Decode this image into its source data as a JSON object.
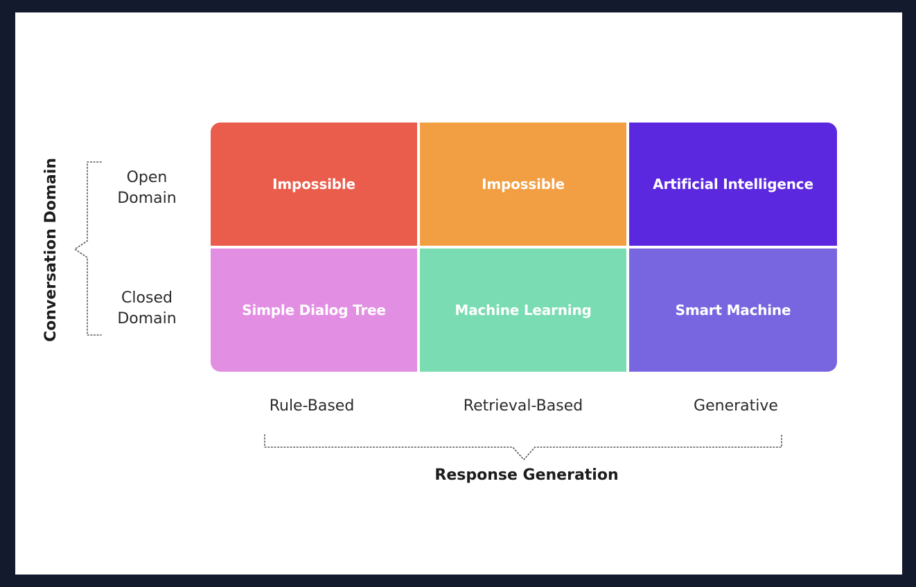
{
  "y_axis": {
    "title": "Conversation Domain",
    "rows": [
      {
        "line1": "Open",
        "line2": "Domain"
      },
      {
        "line1": "Closed",
        "line2": "Domain"
      }
    ]
  },
  "x_axis": {
    "title": "Response Generation",
    "columns": [
      "Rule-Based",
      "Retrieval-Based",
      "Generative"
    ]
  },
  "matrix": {
    "cells": [
      [
        {
          "label": "Impossible",
          "color": "#ea5c4b"
        },
        {
          "label": "Impossible",
          "color": "#f29f43"
        },
        {
          "label": "Artificial Intelligence",
          "color": "#5b28df"
        }
      ],
      [
        {
          "label": "Simple Dialog Tree",
          "color": "#e28fe3"
        },
        {
          "label": "Machine Learning",
          "color": "#79dcb2"
        },
        {
          "label": "Smart Machine",
          "color": "#7866e0"
        }
      ]
    ]
  },
  "colors": {
    "page_background": "#131a2d",
    "canvas_background": "#ffffff",
    "text": "#2a2a2a",
    "brace": "#555555"
  }
}
